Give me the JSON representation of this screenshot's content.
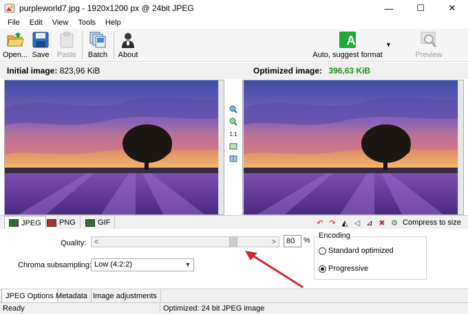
{
  "window": {
    "title": "purpleworld7.jpg - 1920x1200 px @ 24bit JPEG",
    "minimize": "—",
    "maximize": "☐",
    "close": "✕"
  },
  "menu": [
    "File",
    "Edit",
    "View",
    "Tools",
    "Help"
  ],
  "toolbar": {
    "open": "Open...",
    "save": "Save",
    "paste": "Paste",
    "batch": "Batch",
    "about": "About",
    "auto_format": "Auto, suggest format",
    "auto_format_icon": "A",
    "preview": "Preview"
  },
  "images": {
    "initial_label": "Initial image:",
    "initial_size": "823,96 KiB",
    "optimized_label": "Optimized image:",
    "optimized_size": "396,63 KiB"
  },
  "zoom": {
    "one_to_one": "1:1"
  },
  "format_tabs": [
    "JPEG",
    "PNG",
    "GIF"
  ],
  "compress_to_size": "Compress to size",
  "options": {
    "quality_label": "Quality:",
    "quality_value": "80",
    "quality_fraction": 0.8,
    "percent": "%",
    "chroma_label": "Chroma subsampling:",
    "chroma_value": "Low (4:2:2)",
    "encoding_title": "Encoding",
    "standard": "Standard optimized",
    "progressive": "Progressive"
  },
  "bottom_tabs": [
    "JPEG Options",
    "Metadata",
    "Image adjustments"
  ],
  "status": {
    "left": "Ready",
    "right": "Optimized: 24 bit JPEG image"
  },
  "colors": {
    "green": "#1e8b1e",
    "accent_arrow": "#d0262c"
  }
}
